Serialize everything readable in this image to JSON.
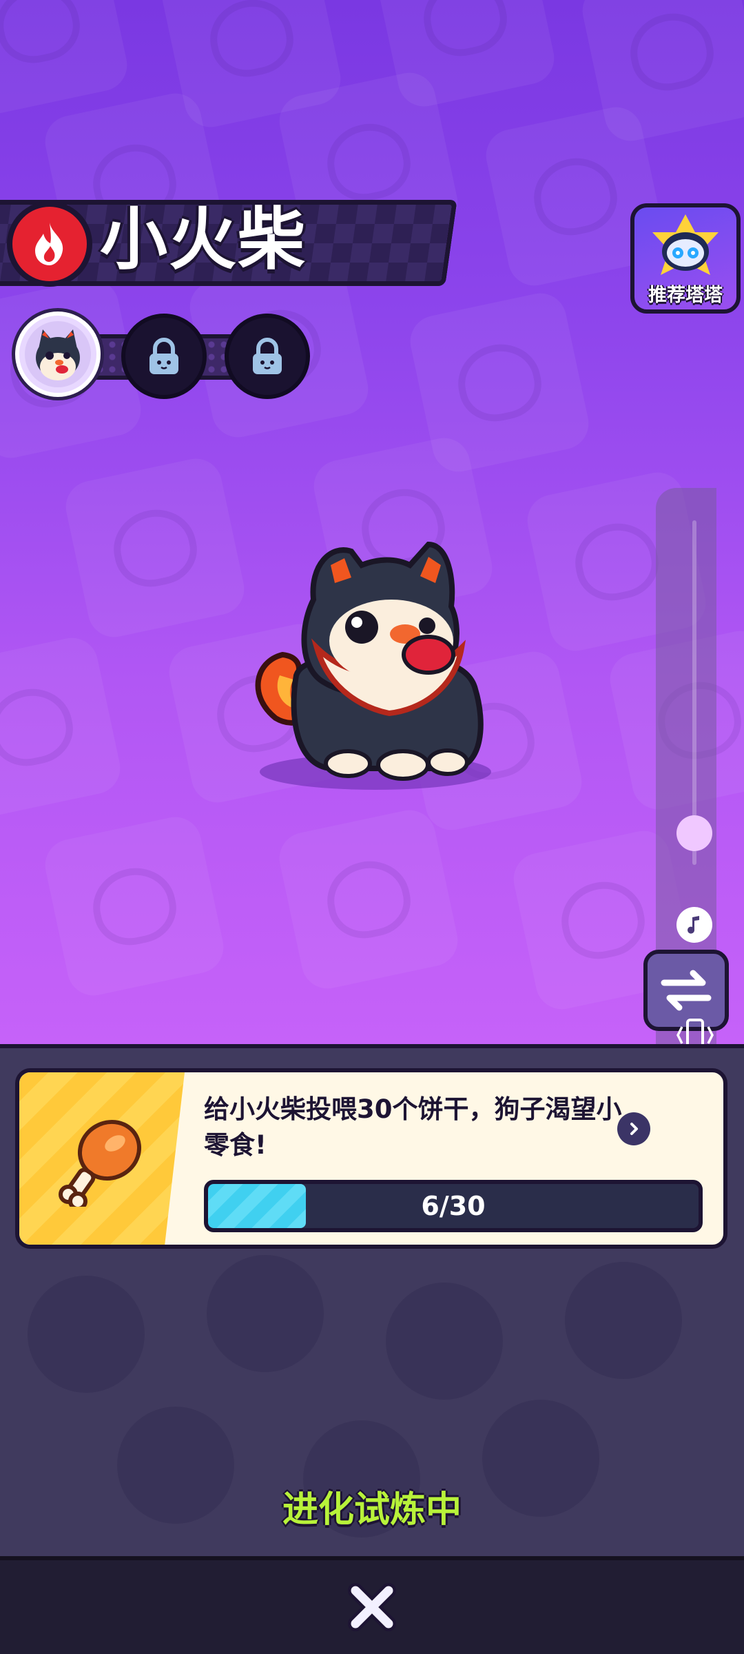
{
  "header": {
    "title": "小火柴",
    "element_icon": "fire-icon"
  },
  "evolution": {
    "stages": [
      {
        "icon": "pet-avatar-icon",
        "locked": false
      },
      {
        "icon": "lock-icon",
        "locked": true
      },
      {
        "icon": "lock-icon",
        "locked": true
      }
    ]
  },
  "recommend": {
    "label": "推荐塔塔",
    "icon": "robot-icon"
  },
  "side_controls": {
    "icons": [
      "slider-knob",
      "music-note-icon",
      "switch-arrows-icon",
      "vibrate-icon",
      "more-vertical-icon"
    ]
  },
  "quest": {
    "text": "给小火柴投喂30个饼干，狗子渴望小零食!",
    "icon": "drumstick-icon",
    "progress_label": "6/30",
    "progress_fraction": 0.2
  },
  "status": {
    "label": "进化试炼中"
  },
  "bottom": {
    "close_icon": "close-icon"
  },
  "colors": {
    "stage_top": "#7a38e2",
    "stage_bottom": "#c662f9",
    "fire_red": "#e52230",
    "status_green": "#b8f23a",
    "progress_cyan": "#40d0f0"
  }
}
